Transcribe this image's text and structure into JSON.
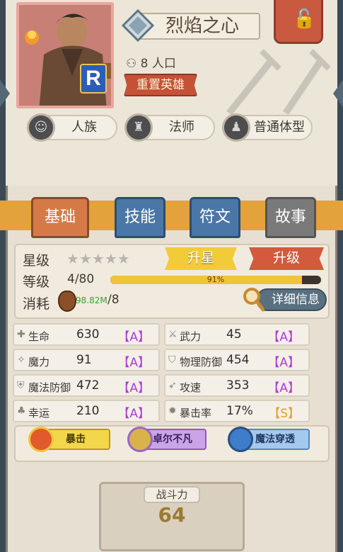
{
  "hero": {
    "name": "烈焰之心",
    "rank": "R",
    "population": "8 人口",
    "reset_label": "重置英雄"
  },
  "tags": [
    {
      "label": "人族",
      "icon": "human-face-icon"
    },
    {
      "label": "法师",
      "icon": "mage-hood-icon"
    },
    {
      "label": "普通体型",
      "icon": "body-silhouette-icon"
    }
  ],
  "tabs": [
    {
      "label": "基础",
      "state": "active"
    },
    {
      "label": "技能",
      "state": "normal"
    },
    {
      "label": "符文",
      "state": "normal"
    },
    {
      "label": "故事",
      "state": "disabled"
    }
  ],
  "basic": {
    "star_label": "星级",
    "stars_total": 5,
    "stars_filled": 0,
    "upstar_label": "升星",
    "level_label": "等级",
    "level_value": "4/80",
    "uplevel_label": "升级",
    "progress_percent": 91,
    "progress_text": "91%",
    "cost_label": "消耗",
    "cost_have": "98.82M",
    "cost_need": "/8",
    "detail_label": "详细信息"
  },
  "attributes": [
    {
      "name": "生命",
      "value": "630",
      "grade": "【A】",
      "icon": "life-icon"
    },
    {
      "name": "武力",
      "value": "45",
      "grade": "【A】",
      "icon": "sword-icon"
    },
    {
      "name": "魔力",
      "value": "91",
      "grade": "【A】",
      "icon": "magic-icon"
    },
    {
      "name": "物理防御",
      "value": "454",
      "grade": "【A】",
      "icon": "shield-icon"
    },
    {
      "name": "魔法防御",
      "value": "472",
      "grade": "【A】",
      "icon": "magic-shield-icon"
    },
    {
      "name": "攻速",
      "value": "353",
      "grade": "【A】",
      "icon": "wing-icon"
    },
    {
      "name": "幸运",
      "value": "210",
      "grade": "【A】",
      "icon": "clover-icon"
    },
    {
      "name": "暴击率",
      "value": "17%",
      "grade": "【S】",
      "icon": "burst-icon"
    }
  ],
  "skills": [
    {
      "label": "暴击",
      "color": "#f2d74a"
    },
    {
      "label": "卓尔不凡",
      "color": "#b78ad9"
    },
    {
      "label": "魔法穿透",
      "color": "#8cb6e6"
    }
  ],
  "power": {
    "label": "战斗力",
    "value": "64"
  },
  "colors": {
    "grade_a": "#b03ad6",
    "grade_s": "#e0a11a",
    "tab_bar": "#e3a23b"
  }
}
